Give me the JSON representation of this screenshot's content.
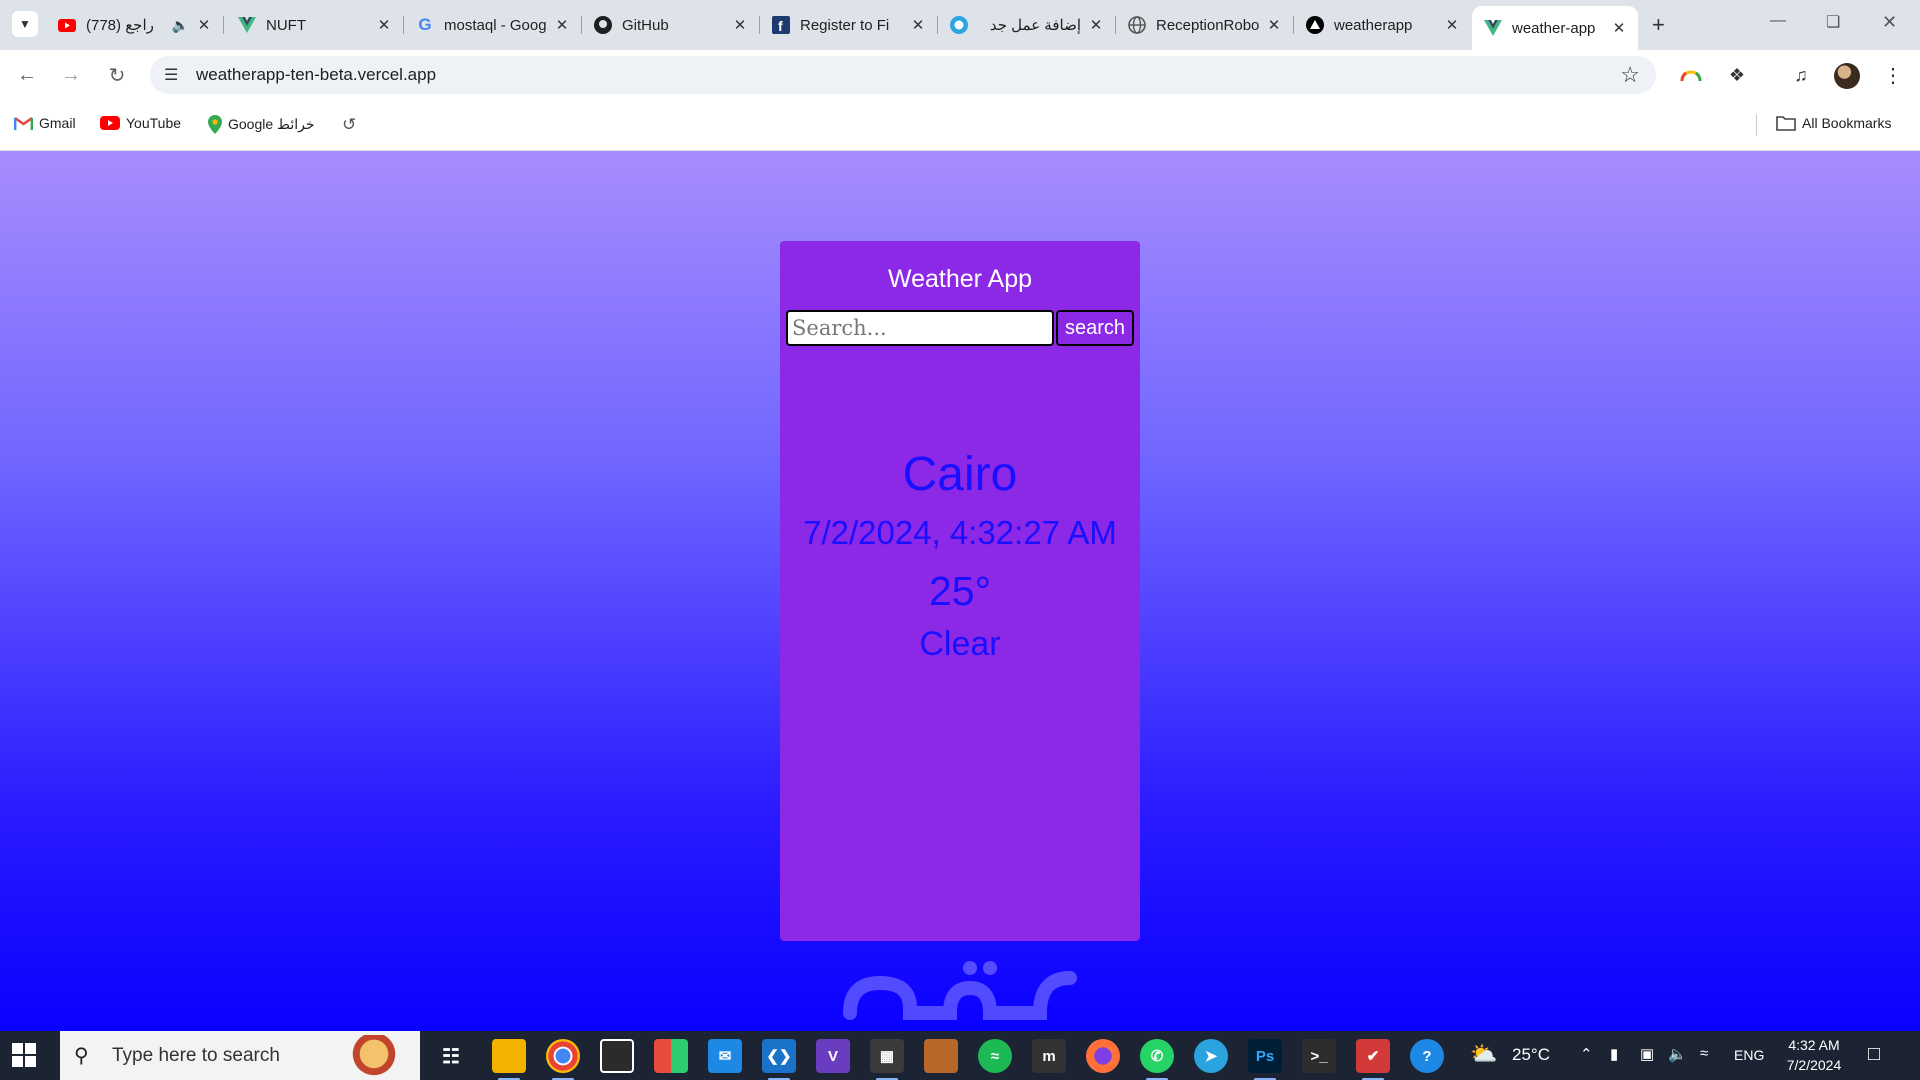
{
  "browser": {
    "tabs": [
      {
        "title": "(778) راجع",
        "icon": "youtube-icon",
        "audio": true
      },
      {
        "title": "NUFT",
        "icon": "vue-icon"
      },
      {
        "title": "mostaql - Google",
        "icon": "google-icon"
      },
      {
        "title": "GitHub",
        "icon": "github-icon"
      },
      {
        "title": "Register to Fi",
        "icon": "facebook-icon"
      },
      {
        "title": "إضافة عمل جد",
        "icon": "mostaql-icon"
      },
      {
        "title": "ReceptionRobot",
        "icon": "globe-icon"
      },
      {
        "title": "weatherapp",
        "icon": "vercel-icon"
      },
      {
        "title": "weather-app",
        "icon": "vue-icon",
        "active": true
      }
    ],
    "url": "weatherapp-ten-beta.vercel.app",
    "bookmarks": [
      {
        "label": "Gmail",
        "icon": "gmail-icon"
      },
      {
        "label": "YouTube",
        "icon": "youtube-icon"
      },
      {
        "label": "Google خرائط",
        "icon": "maps-icon"
      }
    ],
    "all_bookmarks": "All Bookmarks"
  },
  "app": {
    "title": "Weather App",
    "search_placeholder": "Search...",
    "search_button": "search",
    "city": "Cairo",
    "datetime": "7/2/2024, 4:32:27 AM",
    "temperature": "25°",
    "description": "Clear",
    "watermark": "مستقل"
  },
  "taskbar": {
    "search_placeholder": "Type here to search",
    "weather": "25°C",
    "language": "ENG",
    "time": "4:32 AM",
    "date": "7/2/2024"
  },
  "colors": {
    "card": "#8b29e6",
    "weather_text": "#1a0fff",
    "page_top": "#a88cfe",
    "page_bottom": "#0a00ff"
  }
}
